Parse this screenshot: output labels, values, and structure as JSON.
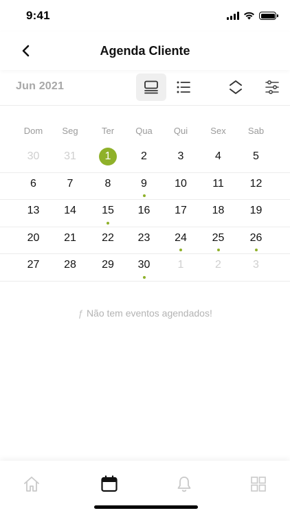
{
  "status_bar": {
    "time": "9:41"
  },
  "header": {
    "title": "Agenda Cliente",
    "back_icon": "chevron-left-icon"
  },
  "toolbar": {
    "month_label": "Jun 2021",
    "buttons": [
      "calendar-view-icon",
      "list-view-icon",
      "collapse-icon",
      "filter-sliders-icon"
    ]
  },
  "calendar": {
    "weekdays": [
      "Dom",
      "Seg",
      "Ter",
      "Qua",
      "Qui",
      "Sex",
      "Sab"
    ],
    "today_color": "#8fb12a",
    "event_dot_color": "#8fb12a",
    "weeks": [
      [
        {
          "day": "30",
          "muted": true
        },
        {
          "day": "31",
          "muted": true
        },
        {
          "day": "1",
          "today": true
        },
        {
          "day": "2"
        },
        {
          "day": "3"
        },
        {
          "day": "4"
        },
        {
          "day": "5"
        }
      ],
      [
        {
          "day": "6"
        },
        {
          "day": "7"
        },
        {
          "day": "8"
        },
        {
          "day": "9",
          "event": true
        },
        {
          "day": "10"
        },
        {
          "day": "11"
        },
        {
          "day": "12"
        }
      ],
      [
        {
          "day": "13"
        },
        {
          "day": "14"
        },
        {
          "day": "15",
          "event": true
        },
        {
          "day": "16"
        },
        {
          "day": "17"
        },
        {
          "day": "18"
        },
        {
          "day": "19"
        }
      ],
      [
        {
          "day": "20"
        },
        {
          "day": "21"
        },
        {
          "day": "22"
        },
        {
          "day": "23"
        },
        {
          "day": "24",
          "event": true
        },
        {
          "day": "25",
          "event": true
        },
        {
          "day": "26",
          "event": true
        }
      ],
      [
        {
          "day": "27"
        },
        {
          "day": "28"
        },
        {
          "day": "29"
        },
        {
          "day": "30",
          "event": true
        },
        {
          "day": "1",
          "muted": true
        },
        {
          "day": "2",
          "muted": true
        },
        {
          "day": "3",
          "muted": true
        }
      ]
    ]
  },
  "empty_state": {
    "icon": "ƒ",
    "message": "Não tem eventos agendados!"
  },
  "tab_bar": {
    "items": [
      "home-icon",
      "calendar-icon",
      "bell-icon",
      "grid-icon"
    ],
    "active": "calendar-icon"
  }
}
